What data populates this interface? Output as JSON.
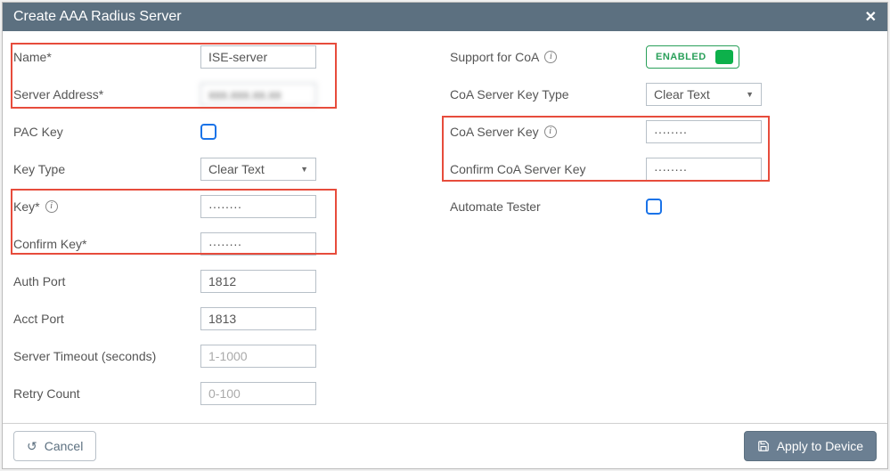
{
  "title": "Create AAA Radius Server",
  "left": {
    "name_label": "Name*",
    "name_value": "ISE-server",
    "server_address_label": "Server Address*",
    "server_address_value": "xxx.xxx.xx.xx",
    "pac_key_label": "PAC Key",
    "key_type_label": "Key Type",
    "key_type_value": "Clear Text",
    "key_label": "Key*",
    "key_value": "········",
    "confirm_key_label": "Confirm Key*",
    "confirm_key_value": "········",
    "auth_port_label": "Auth Port",
    "auth_port_value": "1812",
    "acct_port_label": "Acct Port",
    "acct_port_value": "1813",
    "server_timeout_label": "Server Timeout (seconds)",
    "server_timeout_placeholder": "1-1000",
    "retry_count_label": "Retry Count",
    "retry_count_placeholder": "0-100"
  },
  "right": {
    "coa_support_label": "Support for CoA",
    "coa_enabled_text": "ENABLED",
    "coa_key_type_label": "CoA Server Key Type",
    "coa_key_type_value": "Clear Text",
    "coa_key_label": "CoA Server Key",
    "coa_key_value": "········",
    "confirm_coa_key_label": "Confirm CoA Server Key",
    "confirm_coa_key_value": "········",
    "automate_tester_label": "Automate Tester"
  },
  "footer": {
    "cancel": "Cancel",
    "apply": "Apply to Device"
  }
}
